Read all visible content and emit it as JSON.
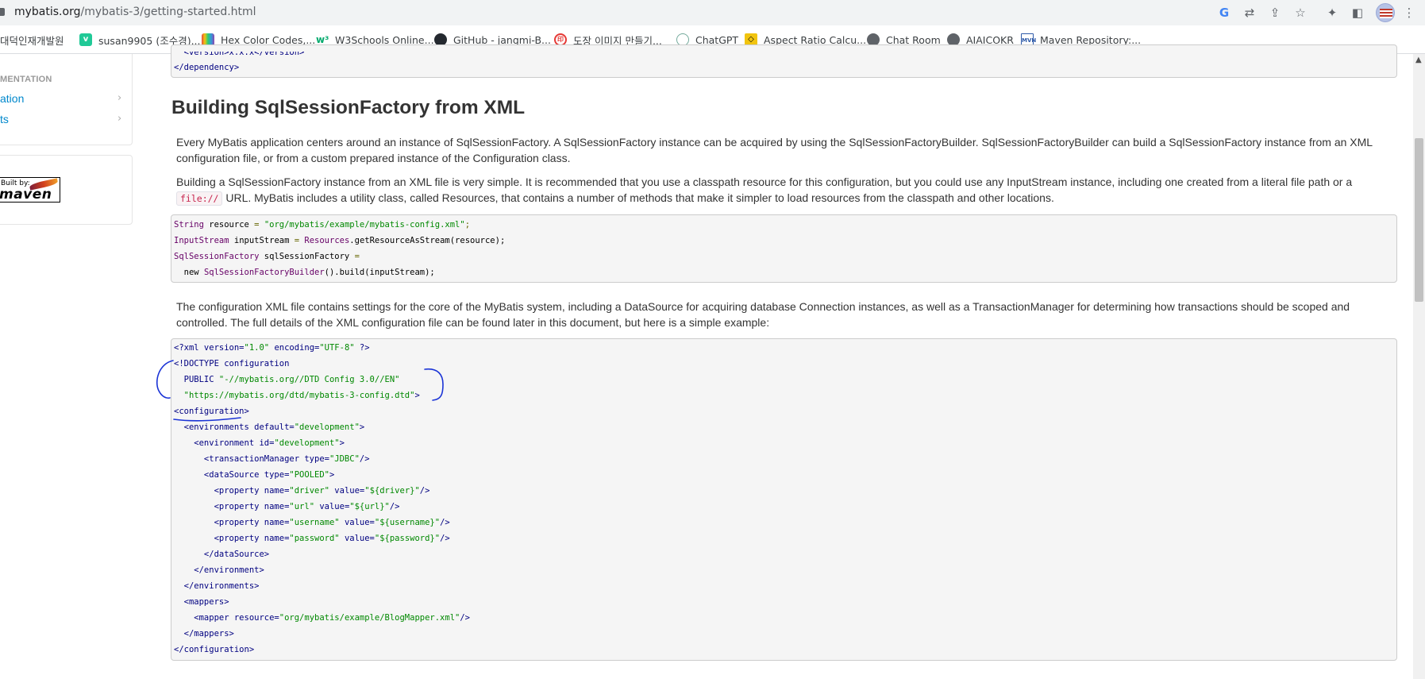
{
  "browser": {
    "url_domain": "mybatis.org",
    "url_path": "/mybatis-3/getting-started.html",
    "toolbar_icons": [
      "google-icon",
      "translate-icon",
      "share-icon",
      "bookmark-star-icon",
      "extensions-icon",
      "sidebar-icon",
      "profile-avatar",
      "menu-icon"
    ]
  },
  "bookmarks": [
    {
      "label": "대덕인재개발원",
      "icon": "folder-icon",
      "color": "#5f6368"
    },
    {
      "label": "susan9905 (조수경)...",
      "icon": "velog-icon",
      "color": "#20c997"
    },
    {
      "label": "Hex Color Codes,...",
      "icon": "hex-icon",
      "color": "#8e44ad"
    },
    {
      "label": "W3Schools Online...",
      "icon": "w3schools-icon",
      "color": "#04aa6d"
    },
    {
      "label": "GitHub - jangmi-B...",
      "icon": "github-icon",
      "color": "#24292f"
    },
    {
      "label": "도장 이미지 만들기...",
      "icon": "stamp-icon",
      "color": "#e53935"
    },
    {
      "label": "ChatGPT",
      "icon": "chatgpt-icon",
      "color": "#74aa9c"
    },
    {
      "label": "Aspect Ratio Calcu...",
      "icon": "aspect-ratio-icon",
      "color": "#f1c40f"
    },
    {
      "label": "Chat Room",
      "icon": "globe-icon",
      "color": "#5f6368"
    },
    {
      "label": "AIAICOKR",
      "icon": "globe-icon",
      "color": "#5f6368"
    },
    {
      "label": "Maven Repository:...",
      "icon": "maven-repo-icon",
      "color": "#2e5aa8"
    }
  ],
  "sidebar": {
    "heading": "MENTATION",
    "items": [
      {
        "label": "ation"
      },
      {
        "label": "ts"
      }
    ],
    "built_by": "Built by:",
    "maven": "maven"
  },
  "top_code": {
    "partial_line": "  <version>x.x.x</version>",
    "closing": "</dependency>"
  },
  "section_title": "Building SqlSessionFactory from XML",
  "paragraphs": {
    "p1": "Every MyBatis application centers around an instance of SqlSessionFactory. A SqlSessionFactory instance can be acquired by using the SqlSessionFactoryBuilder. SqlSessionFactoryBuilder can build a SqlSessionFactory instance from an XML configuration file, or from a custom prepared instance of the Configuration class.",
    "p2_before": "Building a SqlSessionFactory instance from an XML file is very simple. It is recommended that you use a classpath resource for this configuration, but you could use any InputStream instance, including one created from a literal file path or a ",
    "p2_code": "file://",
    "p2_after": " URL. MyBatis includes a utility class, called Resources, that contains a number of methods that make it simpler to load resources from the classpath and other locations.",
    "p3": "The configuration XML file contains settings for the core of the MyBatis system, including a DataSource for acquiring database Connection instances, as well as a TransactionManager for determining how transactions should be scoped and controlled. The full details of the XML configuration file can be found later in this document, but here is a simple example:"
  },
  "java_code": {
    "l1_type": "String",
    "l1_var": " resource ",
    "l1_eq": "= ",
    "l1_str": "\"org/mybatis/example/mybatis-config.xml\"",
    "l1_end": ";",
    "l2_type": "InputStream",
    "l2_var": " inputStream ",
    "l2_eq": "= ",
    "l2_cls": "Resources",
    "l2_call": ".getResourceAsStream(resource);",
    "l3_type": "SqlSessionFactory",
    "l3_var": " sqlSessionFactory ",
    "l3_eq": "=",
    "l4_new": "  new ",
    "l4_cls": "SqlSessionFactoryBuilder",
    "l4_call": "().build(inputStream);"
  },
  "xml_code": {
    "l1_a": "<?xml version=",
    "l1_b": "\"1.0\"",
    "l1_c": " encoding=",
    "l1_d": "\"UTF-8\"",
    "l1_e": " ?>",
    "l2": "<!DOCTYPE configuration",
    "l3_a": "  PUBLIC ",
    "l3_b": "\"-//mybatis.org//DTD Config 3.0//EN\"",
    "l4_a": "  ",
    "l4_b": "\"https://mybatis.org/dtd/mybatis-3-config.dtd\"",
    "l4_c": ">",
    "l5": "<configuration>",
    "l6_a": "  <environments default=",
    "l6_b": "\"development\"",
    "l6_c": ">",
    "l7_a": "    <environment id=",
    "l7_b": "\"development\"",
    "l7_c": ">",
    "l8_a": "      <transactionManager type=",
    "l8_b": "\"JDBC\"",
    "l8_c": "/>",
    "l9_a": "      <dataSource type=",
    "l9_b": "\"POOLED\"",
    "l9_c": ">",
    "l10_a": "        <property name=",
    "l10_b": "\"driver\"",
    "l10_c": " value=",
    "l10_d": "\"${driver}\"",
    "l10_e": "/>",
    "l11_a": "        <property name=",
    "l11_b": "\"url\"",
    "l11_c": " value=",
    "l11_d": "\"${url}\"",
    "l11_e": "/>",
    "l12_a": "        <property name=",
    "l12_b": "\"username\"",
    "l12_c": " value=",
    "l12_d": "\"${username}\"",
    "l12_e": "/>",
    "l13_a": "        <property name=",
    "l13_b": "\"password\"",
    "l13_c": " value=",
    "l13_d": "\"${password}\"",
    "l13_e": "/>",
    "l14": "      </dataSource>",
    "l15": "    </environment>",
    "l16": "  </environments>",
    "l17": "  <mappers>",
    "l18_a": "    <mapper resource=",
    "l18_b": "\"org/mybatis/example/BlogMapper.xml\"",
    "l18_c": "/>",
    "l19": "  </mappers>",
    "l20": "</configuration>"
  },
  "colors": {
    "link": "#0088cc",
    "annotation": "#1a33d6",
    "code_bg": "#f5f5f5"
  }
}
